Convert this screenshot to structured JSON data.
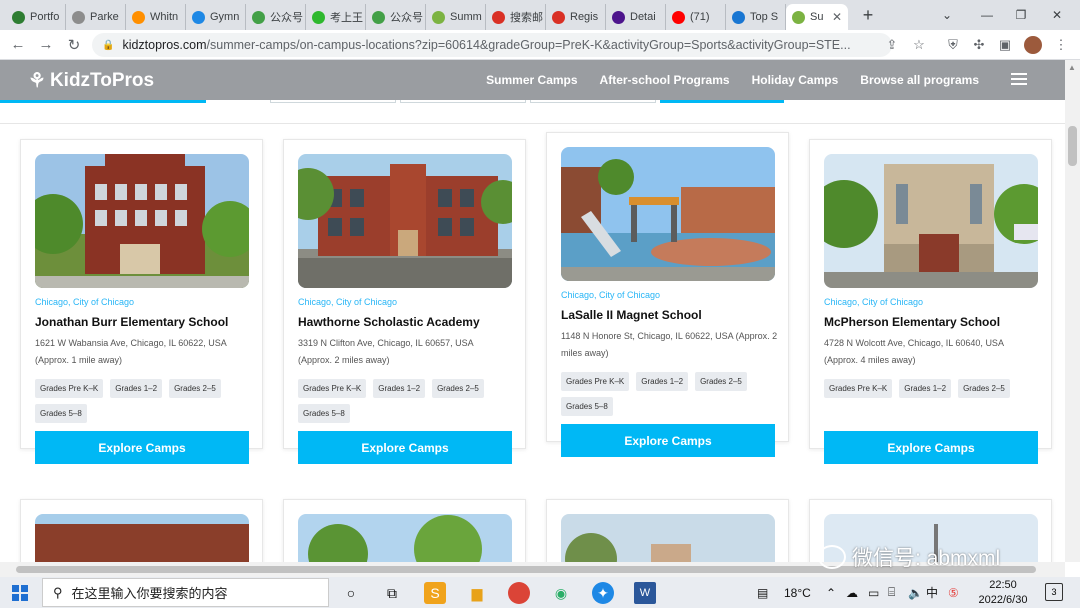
{
  "browser": {
    "tabs": [
      {
        "label": "Portfo",
        "color": "#2e7d32"
      },
      {
        "label": "Parke",
        "color": "#8d8d8d"
      },
      {
        "label": "Whitn",
        "color": "#ff8f00"
      },
      {
        "label": "Gymn",
        "color": "#1e88e5"
      },
      {
        "label": "公众号",
        "color": "#43a047"
      },
      {
        "label": "考上王",
        "color": "#2eb82e"
      },
      {
        "label": "公众号",
        "color": "#43a047"
      },
      {
        "label": "Summ",
        "color": "#7cb342"
      },
      {
        "label": "搜索邮",
        "color": "#d93025"
      },
      {
        "label": "Regis",
        "color": "#d93025"
      },
      {
        "label": "Detai",
        "color": "#4d148c"
      },
      {
        "label": "(71)",
        "color": "#ff0000"
      },
      {
        "label": "Top S",
        "color": "#1976d2"
      },
      {
        "label": "Su",
        "color": "#7cb342",
        "active": true
      }
    ],
    "url_domain": "kidztopros.com",
    "url_path": "/summer-camps/on-campus-locations?zip=60614&gradeGroup=PreK-K&activityGroup=Sports&activityGroup=STE..."
  },
  "site": {
    "logo": "KidzToPros",
    "nav": [
      "Summer Camps",
      "After-school Programs",
      "Holiday Camps",
      "Browse all programs"
    ]
  },
  "schools": [
    {
      "location": "Chicago, City of Chicago",
      "name": "Jonathan Burr Elementary School",
      "address": "1621 W Wabansia Ave, Chicago, IL 60622, USA",
      "distance": "(Approx. 1 mile away)",
      "grades": [
        "Grades Pre K–K",
        "Grades 1–2",
        "Grades 2–5",
        "Grades 5–8"
      ],
      "cta": "Explore Camps"
    },
    {
      "location": "Chicago, City of Chicago",
      "name": "Hawthorne Scholastic Academy",
      "address": "3319 N Clifton Ave, Chicago, IL 60657, USA",
      "distance": "(Approx. 2 miles away)",
      "grades": [
        "Grades Pre K–K",
        "Grades 1–2",
        "Grades 2–5",
        "Grades 5–8"
      ],
      "cta": "Explore Camps"
    },
    {
      "location": "Chicago, City of Chicago",
      "name": "LaSalle II Magnet School",
      "address": "1148 N Honore St, Chicago, IL 60622, USA (Approx. 2 miles away)",
      "distance": "",
      "grades": [
        "Grades Pre K–K",
        "Grades 1–2",
        "Grades 2–5",
        "Grades 5–8"
      ],
      "cta": "Explore Camps"
    },
    {
      "location": "Chicago, City of Chicago",
      "name": "McPherson Elementary School",
      "address": "4728 N Wolcott Ave, Chicago, IL 60640, USA",
      "distance": "(Approx. 4 miles away)",
      "grades": [
        "Grades Pre K–K",
        "Grades 1–2",
        "Grades 2–5"
      ],
      "cta": "Explore Camps"
    }
  ],
  "taskbar": {
    "search_placeholder": "在这里输入你要搜索的内容",
    "temperature": "18°C",
    "ime": "中",
    "time": "22:50",
    "date": "2022/6/30",
    "notifications": "3"
  },
  "watermark": "微信号: abmxml"
}
